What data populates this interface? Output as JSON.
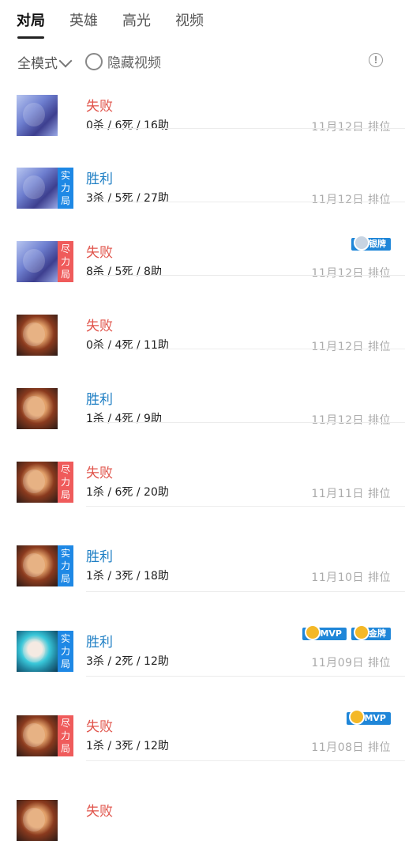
{
  "tabs": [
    "对局",
    "英雄",
    "高光",
    "视频"
  ],
  "filters": {
    "mode_label": "全模式",
    "hide_video_label": "隐藏视频",
    "info_symbol": "!"
  },
  "matches": [
    {
      "result": "失败",
      "result_type": "loss",
      "kda": "0杀 / 6死 / 16助",
      "date": "11月12日",
      "type": "排位",
      "badge": null,
      "honors": [],
      "avatar_icon": "purple-hair-hero-icon"
    },
    {
      "result": "胜利",
      "result_type": "win",
      "kda": "3杀 / 5死 / 27助",
      "date": "11月12日",
      "type": "排位",
      "badge": "实力局",
      "badge_color": "#1e88e5",
      "honors": [],
      "avatar_icon": "purple-hair-hero-icon"
    },
    {
      "result": "失败",
      "result_type": "loss",
      "kda": "8杀 / 5死 / 8助",
      "date": "11月12日",
      "type": "排位",
      "badge": "尽力局",
      "badge_color": "#ef5b5b",
      "honors": [
        "银牌"
      ],
      "avatar_icon": "purple-hair-hero-icon"
    },
    {
      "result": "失败",
      "result_type": "loss",
      "kda": "0杀 / 4死 / 11助",
      "date": "11月12日",
      "type": "排位",
      "badge": null,
      "honors": [],
      "avatar_icon": "monkey-king-hero-icon"
    },
    {
      "result": "胜利",
      "result_type": "win",
      "kda": "1杀 / 4死 / 9助",
      "date": "11月12日",
      "type": "排位",
      "badge": null,
      "honors": [],
      "avatar_icon": "monkey-king-hero-icon"
    },
    {
      "result": "失败",
      "result_type": "loss",
      "kda": "1杀 / 6死 / 20助",
      "date": "11月11日",
      "type": "排位",
      "badge": "尽力局",
      "badge_color": "#ef5b5b",
      "honors": [],
      "avatar_icon": "monkey-king-hero-icon"
    },
    {
      "result": "胜利",
      "result_type": "win",
      "kda": "1杀 / 3死 / 18助",
      "date": "11月10日",
      "type": "排位",
      "badge": "实力局",
      "badge_color": "#1e88e5",
      "honors": [],
      "avatar_icon": "monkey-king-hero-icon"
    },
    {
      "result": "胜利",
      "result_type": "win",
      "kda": "3杀 / 2死 / 12助",
      "date": "11月09日",
      "type": "排位",
      "badge": "实力局",
      "badge_color": "#1e88e5",
      "honors": [
        "MVP",
        "金牌"
      ],
      "avatar_icon": "cyan-hair-hero-icon"
    },
    {
      "result": "失败",
      "result_type": "loss",
      "kda": "1杀 / 3死 / 12助",
      "date": "11月08日",
      "type": "排位",
      "badge": "尽力局",
      "badge_color": "#ef5b5b",
      "honors": [
        "MVP"
      ],
      "avatar_icon": "monkey-king-hero-icon"
    },
    {
      "result": "失败",
      "result_type": "loss",
      "kda": "",
      "date": "",
      "type": "",
      "badge": null,
      "honors": [],
      "avatar_icon": "monkey-king-hero-icon"
    }
  ]
}
